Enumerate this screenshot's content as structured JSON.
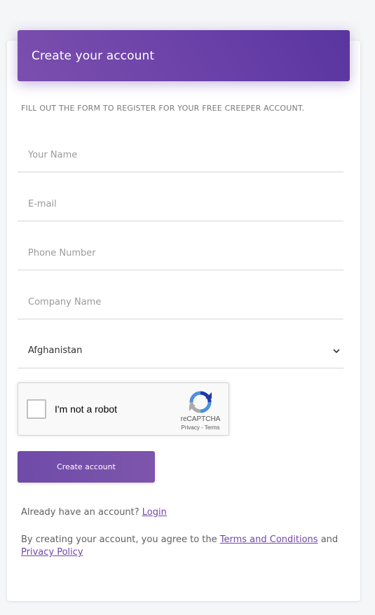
{
  "header": {
    "title": "Create your account"
  },
  "form": {
    "subtitle": "FILL OUT THE FORM TO REGISTER FOR YOUR FREE CREEPER ACCOUNT.",
    "name": {
      "placeholder": "Your Name",
      "value": ""
    },
    "email": {
      "placeholder": "E-mail",
      "value": ""
    },
    "phone": {
      "placeholder": "Phone Number",
      "value": ""
    },
    "company": {
      "placeholder": "Company Name",
      "value": ""
    },
    "country": {
      "selected": "Afghanistan"
    },
    "submit_label": "Create account"
  },
  "recaptcha": {
    "label": "I'm not a robot",
    "brand": "reCAPTCHA",
    "privacy_link": "Privacy",
    "separator": " - ",
    "terms_link": "Terms",
    "checked": false
  },
  "footer": {
    "login_prompt": "Already have an account? ",
    "login_link": "Login",
    "terms_prefix": "By creating your account, you agree to the ",
    "terms_link": "Terms and Conditions",
    "terms_and": " and ",
    "privacy_link": "Privacy Policy"
  },
  "colors": {
    "accent": "#6a41a8",
    "link": "#7346a8",
    "background": "#f5f6f8"
  }
}
